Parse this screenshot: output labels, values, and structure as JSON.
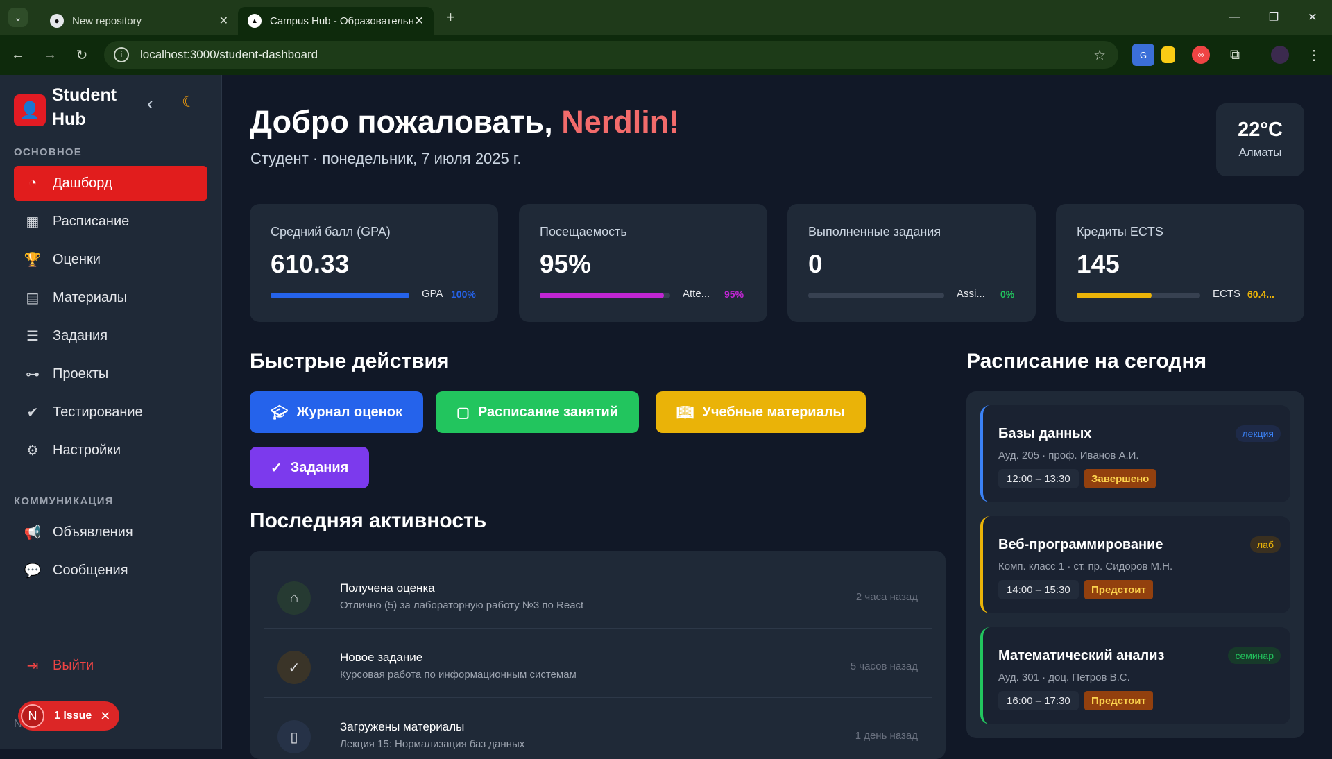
{
  "browser": {
    "tabs": [
      {
        "title": "New repository",
        "active": false
      },
      {
        "title": "Campus Hub - Образовательн",
        "active": true
      }
    ],
    "url": "localhost:3000/student-dashboard"
  },
  "sidebar": {
    "brand_line1": "Student",
    "brand_line2": "Hub",
    "section_main": "ОСНОВНОЕ",
    "nav_main": [
      {
        "label": "Дашборд",
        "icon": "dashboard-icon",
        "active": true
      },
      {
        "label": "Расписание",
        "icon": "calendar-icon"
      },
      {
        "label": "Оценки",
        "icon": "trophy-icon"
      },
      {
        "label": "Материалы",
        "icon": "book-icon"
      },
      {
        "label": "Задания",
        "icon": "tasks-icon"
      },
      {
        "label": "Проекты",
        "icon": "project-icon"
      },
      {
        "label": "Тестирование",
        "icon": "clipboard-check-icon"
      },
      {
        "label": "Настройки",
        "icon": "user-gear-icon"
      }
    ],
    "section_comm": "КОММУНИКАЦИЯ",
    "nav_comm": [
      {
        "label": "Объявления",
        "icon": "megaphone-icon"
      },
      {
        "label": "Сообщения",
        "icon": "chat-icon"
      }
    ],
    "logout": "Выйти",
    "issue_label": "1 Issue",
    "issue_avatar": "N",
    "footer_letter": "N"
  },
  "header": {
    "welcome_prefix": "Добро пожаловать, ",
    "user_name": "Nerdlin!",
    "subtitle": "Студент · понедельник, 7 июля 2025 г."
  },
  "weather": {
    "temp": "22°C",
    "city": "Алматы"
  },
  "stats": [
    {
      "label": "Средний балл (GPA)",
      "value": "610.33",
      "tag": "GPA",
      "pct": "100%",
      "fill": 1.0,
      "color": "#2563eb"
    },
    {
      "label": "Посещаемость",
      "value": "95%",
      "tag": "Atte...",
      "pct": "95%",
      "fill": 0.95,
      "color": "#c026d3"
    },
    {
      "label": "Выполненные задания",
      "value": "0",
      "tag": "Assi...",
      "pct": "0%",
      "fill": 0.0,
      "color": "#22c55e"
    },
    {
      "label": "Кредиты ECTS",
      "value": "145",
      "tag": "ECTS",
      "pct": "60.4...",
      "fill": 0.604,
      "color": "#eab308"
    }
  ],
  "quick_actions": {
    "title": "Быстрые действия",
    "buttons": [
      {
        "label": "Журнал оценок",
        "icon": "graduation-cap-icon",
        "color": "#2563eb"
      },
      {
        "label": "Расписание занятий",
        "icon": "calendar-icon",
        "color": "#22c55e"
      },
      {
        "label": "Учебные материалы",
        "icon": "open-book-icon",
        "color": "#eab308"
      },
      {
        "label": "Задания",
        "icon": "check-circle-icon",
        "color": "#7c3aed"
      }
    ]
  },
  "activity": {
    "title": "Последняя активность",
    "items": [
      {
        "title": "Получена оценка",
        "desc": "Отлично (5) за лабораторную работу №3 по React",
        "time": "2 часа назад",
        "icon": "graduation-cap-icon"
      },
      {
        "title": "Новое задание",
        "desc": "Курсовая работа по информационным системам",
        "time": "5 часов назад",
        "icon": "check-circle-icon"
      },
      {
        "title": "Загружены материалы",
        "desc": "Лекция 15: Нормализация баз данных",
        "time": "1 день назад",
        "icon": "open-book-icon"
      }
    ]
  },
  "schedule": {
    "title": "Расписание на сегодня",
    "classes": [
      {
        "name": "Базы данных",
        "type": "лекция",
        "room": "Ауд. 205 · проф. Иванов А.И.",
        "time": "12:00 – 13:30",
        "status": "Завершено",
        "accent": "#3b82f6"
      },
      {
        "name": "Веб-программирование",
        "type": "лаб",
        "room": "Комп. класс 1 · ст. пр. Сидоров М.Н.",
        "time": "14:00 – 15:30",
        "status": "Предстоит",
        "accent": "#eab308"
      },
      {
        "name": "Математический анализ",
        "type": "семинар",
        "room": "Ауд. 301 · доц. Петров В.С.",
        "time": "16:00 – 17:30",
        "status": "Предстоит",
        "accent": "#22c55e"
      }
    ]
  }
}
